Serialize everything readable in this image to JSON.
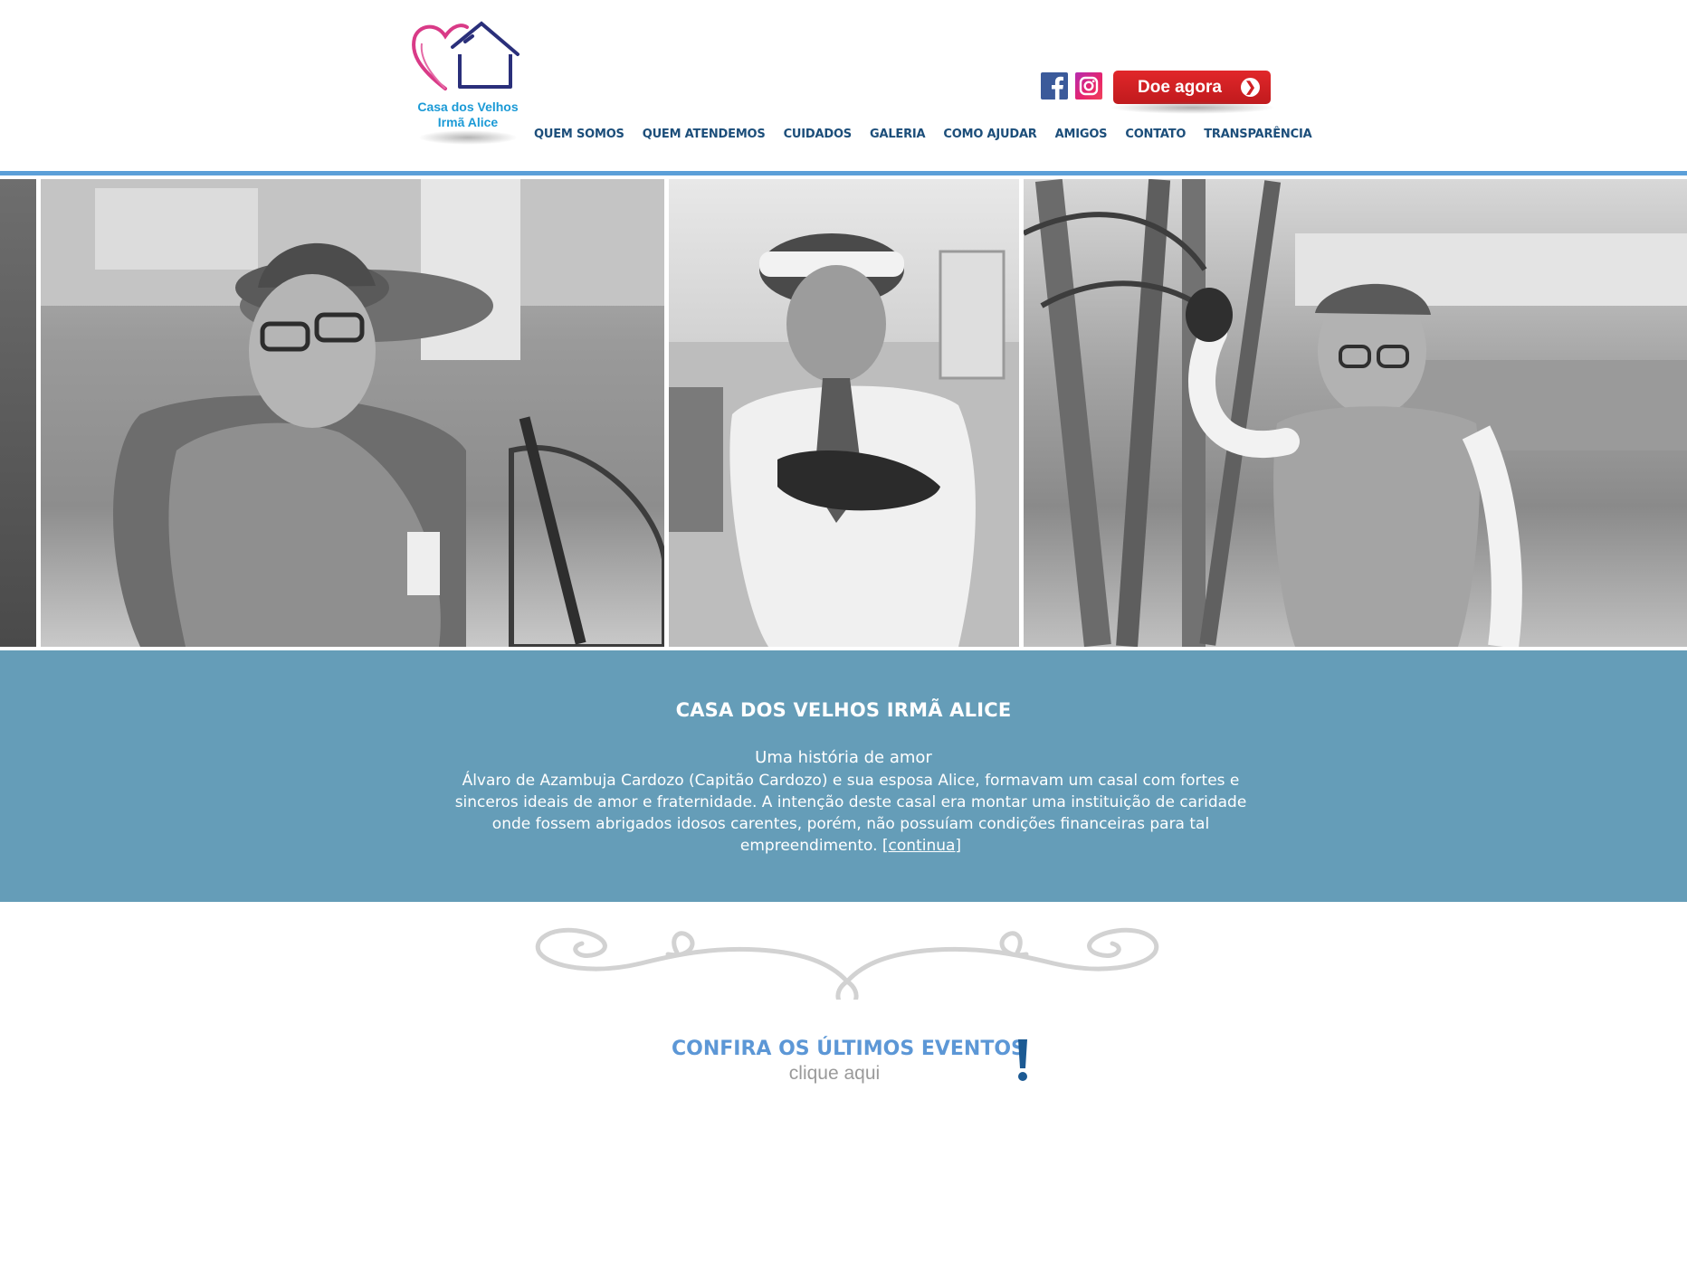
{
  "brand": {
    "name_line_1": "Casa dos Velhos",
    "name_line_2": "Irmã Alice",
    "logo_icon": "heart-house-logo",
    "colors": {
      "heart": "#d93a87",
      "house": "#2a2f7a",
      "text": "#1b9ad6"
    }
  },
  "social": [
    {
      "icon": "facebook-icon",
      "label": "Facebook"
    },
    {
      "icon": "instagram-icon",
      "label": "Instagram"
    }
  ],
  "donate": {
    "label": "Doe agora",
    "icon": "arrow-right-circle-icon",
    "color": "#d12024"
  },
  "nav": [
    {
      "label": "QUEM SOMOS"
    },
    {
      "label": "QUEM ATENDEMOS"
    },
    {
      "label": "CUIDADOS"
    },
    {
      "label": "GALERIA"
    },
    {
      "label": "COMO AJUDAR"
    },
    {
      "label": "AMIGOS"
    },
    {
      "label": "CONTATO"
    },
    {
      "label": "TRANSPARÊNCIA"
    }
  ],
  "gallery": {
    "photos": [
      {
        "description_icon": "photo-partial-edge"
      },
      {
        "description_icon": "photo-elderly-man-with-hat-and-cane"
      },
      {
        "description_icon": "photo-elderly-man-with-ukulele"
      },
      {
        "description_icon": "photo-elderly-man-waving-under-palms"
      }
    ]
  },
  "intro": {
    "title": "CASA DOS VELHOS IRMÃ ALICE",
    "subtitle": "Uma história de amor",
    "body": "Álvaro de Azambuja Cardozo (Capitão Cardozo) e sua esposa Alice, formavam um casal com fortes e sinceros ideais de amor e fraternidade. A intenção deste casal era montar uma instituição de caridade onde fossem abrigados idosos carentes, porém, não possuíam condições financeiras para tal empreendimento. ",
    "more_label": "[continua]",
    "background": "#659db8"
  },
  "events": {
    "title": "CONFIRA OS ÚLTIMOS EVENTOS",
    "subtitle": "clique aqui",
    "icon": "exclamation-icon",
    "color": "#5c97d6"
  }
}
